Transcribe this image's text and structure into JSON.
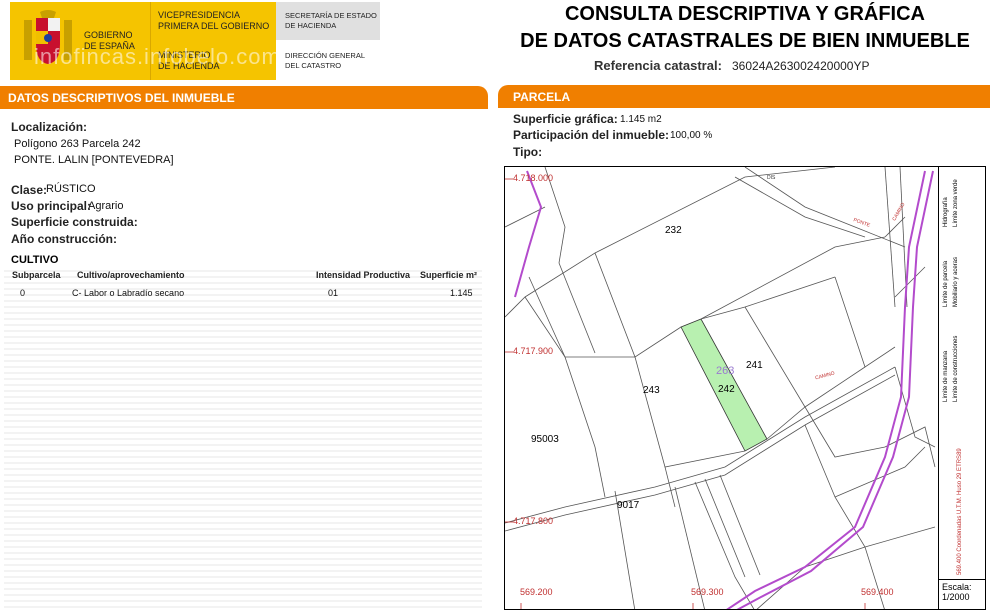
{
  "header": {
    "gov_line1": "GOBIERNO",
    "gov_line2": "DE ESPAÑA",
    "vp_line1": "VICEPRESIDENCIA",
    "vp_line2": "PRIMERA DEL GOBIERNO",
    "min_line1": "MINISTERIO",
    "min_line2": "DE HACIENDA",
    "se_line1": "SECRETARÍA DE ESTADO",
    "se_line2": "DE HACIENDA",
    "dg_line1": "DIRECCIÓN GENERAL",
    "dg_line2": "DEL CATASTRO",
    "watermark": "infofincas.infobelo.com",
    "title_line1": "CONSULTA DESCRIPTIVA Y GRÁFICA",
    "title_line2": "DE DATOS CATASTRALES DE BIEN INMUEBLE",
    "ref_label": "Referencia catastral:",
    "ref_value": "36024A263002420000YP"
  },
  "left": {
    "section_title": "DATOS DESCRIPTIVOS DEL INMUEBLE",
    "localizacion_label": "Localización:",
    "localizacion_line1": "Polígono 263 Parcela 242",
    "localizacion_line2": "PONTE. LALIN [PONTEVEDRA]",
    "clase_label": "Clase:",
    "clase_value": "RÚSTICO",
    "uso_label": "Uso principal:",
    "uso_value": "Agrario",
    "superficie_label": "Superficie construida:",
    "anio_label": "Año construcción:",
    "cultivo_title": "CULTIVO",
    "table_headers": [
      "Subparcela",
      "Cultivo/aprovechamiento",
      "Intensidad Productiva",
      "Superficie m²"
    ],
    "table_rows": [
      [
        "0",
        "C- Labor o Labradío secano",
        "01",
        "1.145"
      ]
    ]
  },
  "right": {
    "section_title": "PARCELA",
    "sup_label": "Superficie gráfica:",
    "sup_value": "1.145 m2",
    "part_label": "Participación del inmueble:",
    "part_value": "100,00 %",
    "tipo_label": "Tipo:",
    "map": {
      "y_labels": [
        "4.718.000",
        "4.717.900",
        "4.717.800"
      ],
      "x_labels": [
        "569.200",
        "569.300",
        "569.400"
      ],
      "parcel_labels": [
        "232",
        "241",
        "243",
        "242",
        "263",
        "95003",
        "9017"
      ],
      "road_labels": [
        "DIS",
        "PONTE",
        "CAMINO",
        "CAMINO"
      ],
      "legend": [
        "Límite de parcela",
        "Mobiliario y aceras",
        "Hidrografía",
        "Límite zona verde",
        "Límite de manzana",
        "Límite de construcciones"
      ],
      "coord_note": "569.400 Coordenadas U.T.M. Huso 29 ETRS89",
      "scale_label": "Escala:",
      "scale_value": "1/2000",
      "highlight_color": "#b8f0b0",
      "boundary_color": "#b34bcc"
    }
  }
}
